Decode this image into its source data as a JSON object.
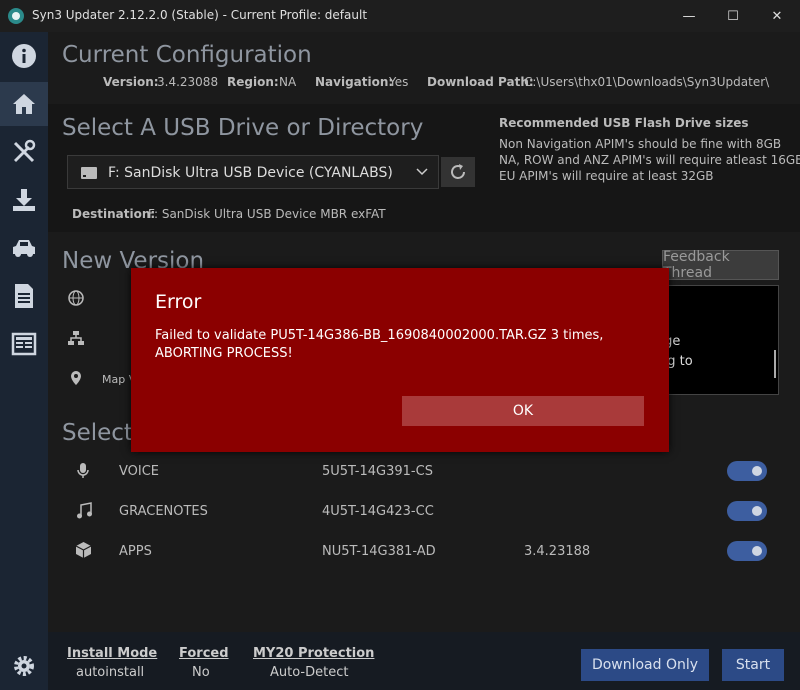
{
  "window": {
    "title": "Syn3 Updater 2.12.2.0 (Stable) - Current Profile: default",
    "minimize_glyph": "—",
    "maximize_glyph": "☐",
    "close_glyph": "✕"
  },
  "config": {
    "title": "Current Configuration",
    "version_label": "Version:",
    "version_value": "3.4.23088",
    "region_label": "Region:",
    "region_value": "NA",
    "navigation_label": "Navigation:",
    "navigation_value": "Yes",
    "download_path_label": "Download Path:",
    "download_path_value": "C:\\Users\\thx01\\Downloads\\Syn3Updater\\"
  },
  "usb": {
    "title": "Select A USB Drive or Directory",
    "selected_drive": "F: SanDisk Ultra USB Device (CYANLABS)",
    "destination_label": "Destination:",
    "destination_value": "F: SanDisk Ultra USB Device  MBR exFAT",
    "recommended_title": "Recommended USB Flash Drive sizes",
    "recommended_lines": [
      "Non Navigation APIM's should be fine with 8GB",
      "NA, ROW and ANZ APIM's will require atleast 16GB",
      "EU APIM's will require at least 32GB"
    ]
  },
  "new_version": {
    "title": "New Version",
    "map_label_partial": "Map V",
    "feedback_button": "Feedback Thread",
    "notes_partial_1": "rge",
    "notes_partial_2": "ng to"
  },
  "select": {
    "title_partial": "Select I",
    "rows": [
      {
        "name": "VOICE",
        "part": "5U5T-14G391-CS",
        "version": ""
      },
      {
        "name": "GRACENOTES",
        "part": "4U5T-14G423-CC",
        "version": ""
      },
      {
        "name": "APPS",
        "part": "NU5T-14G381-AD",
        "version": "3.4.23188"
      }
    ]
  },
  "footer": {
    "install_mode_label": "Install Mode",
    "install_mode_value": "autoinstall",
    "forced_label": "Forced",
    "forced_value": "No",
    "my20_label": "MY20 Protection",
    "my20_value": "Auto-Detect",
    "download_only_button": "Download Only",
    "start_button": "Start"
  },
  "dialog": {
    "title": "Error",
    "message": "Failed to validate PU5T-14G386-BB_1690840002000.TAR.GZ 3 times, ABORTING PROCESS!",
    "ok_button": "OK"
  },
  "colors": {
    "sidebar": "#1b2533",
    "dialog_bg": "#8b0000",
    "ok_button": "#a93a3a",
    "primary_button": "#2c4a86",
    "toggle_on": "#3d5ea0"
  }
}
